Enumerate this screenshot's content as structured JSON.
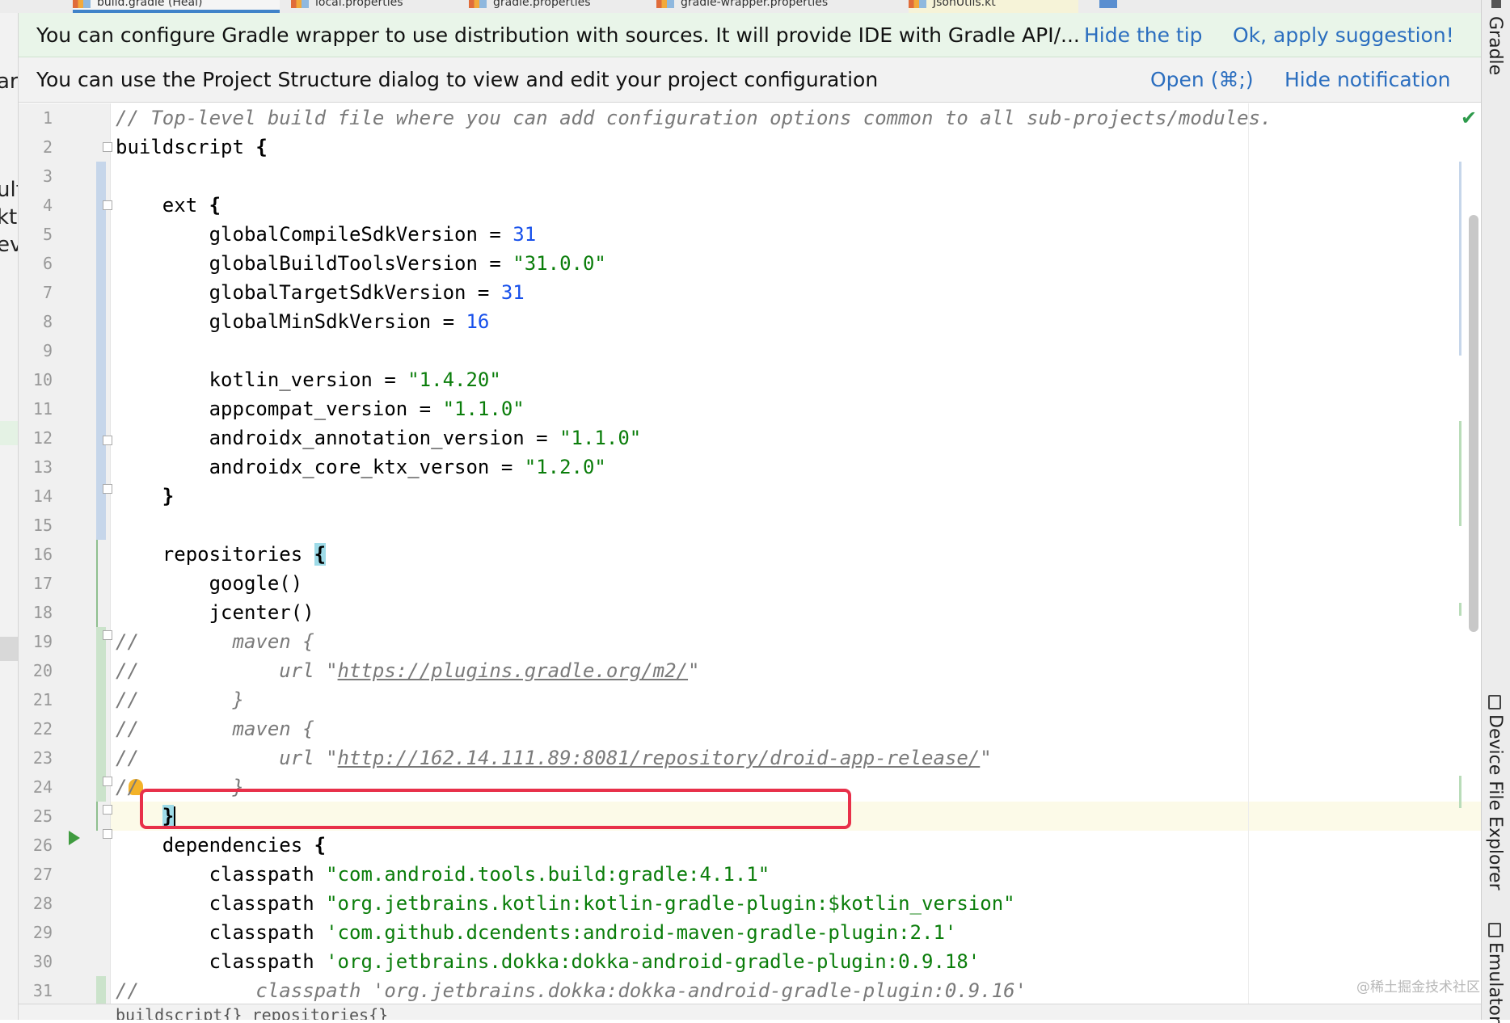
{
  "tabs": [
    {
      "label": "build.gradle (Heal)",
      "active": true
    },
    {
      "label": "local.properties",
      "active": false
    },
    {
      "label": "gradle.properties",
      "active": false
    },
    {
      "label": "gradle-wrapper.properties",
      "active": false
    },
    {
      "label": "JsonUtils.kt",
      "active": false
    }
  ],
  "left_panel": {
    "fragments": [
      "arl",
      "ult",
      "kt",
      "ev"
    ]
  },
  "notifications": {
    "gradle_tip": {
      "text": "You can configure Gradle wrapper to use distribution with sources. It will provide IDE with Gradle API/...",
      "hide_label": "Hide the tip",
      "apply_label": "Ok, apply suggestion!"
    },
    "project_structure": {
      "text": "You can use the Project Structure dialog to view and edit your project configuration",
      "open_label": "Open (⌘;)",
      "hide_label": "Hide notification"
    }
  },
  "editor": {
    "line_numbers": [
      "1",
      "2",
      "3",
      "4",
      "5",
      "6",
      "7",
      "8",
      "9",
      "10",
      "11",
      "12",
      "13",
      "14",
      "15",
      "16",
      "17",
      "18",
      "19",
      "20",
      "21",
      "22",
      "23",
      "24",
      "25",
      "26",
      "27",
      "28",
      "29",
      "30",
      "31"
    ],
    "lines": {
      "l1": "// Top-level build file where you can add configuration options common to all sub-projects/modules.",
      "l2a": "buildscript",
      "l2b": " {",
      "l4a": "    ext",
      "l4b": " {",
      "l5a": "        globalCompileSdkVersion = ",
      "l5b": "31",
      "l6a": "        globalBuildToolsVersion = ",
      "l6b": "\"31.0.0\"",
      "l7a": "        globalTargetSdkVersion = ",
      "l7b": "31",
      "l8a": "        globalMinSdkVersion = ",
      "l8b": "16",
      "l10a": "        kotlin_version = ",
      "l10b": "\"1.4.20\"",
      "l11a": "        appcompat_version = ",
      "l11b": "\"1.1.0\"",
      "l12a": "        androidx_annotation_version = ",
      "l12b": "\"1.1.0\"",
      "l13a": "        androidx_core_ktx_verson = ",
      "l13b": "\"1.2.0\"",
      "l14": "    }",
      "l16a": "    repositories ",
      "l16b": "{",
      "l17": "        google()",
      "l18": "        jcenter()",
      "l19": "//        maven {",
      "l20a": "//            url \"",
      "l20b": "https://plugins.gradle.org/m2/",
      "l20c": "\"",
      "l21": "//        }",
      "l22": "//        maven {",
      "l23a": "//            url \"",
      "l23b": "http://162.14.111.89:8081/repository/droid-app-release/",
      "l23c": "\"",
      "l24": "//        }",
      "l25a": "    ",
      "l25b": "}",
      "l26a": "    dependencies",
      "l26b": " {",
      "l27a": "        classpath ",
      "l27b": "\"com.android.tools.build:gradle:4.1.1\"",
      "l28a": "        classpath ",
      "l28b": "\"org.jetbrains.kotlin:kotlin-gradle-plugin:$kotlin_version\"",
      "l29a": "        classpath ",
      "l29b": "'com.github.dcendents:android-maven-gradle-plugin:2.1'",
      "l30a": "        classpath ",
      "l30b": "'org.jetbrains.dokka:dokka-android-gradle-plugin:0.9.18'",
      "l31": "//          classpath 'org.jetbrains.dokka:dokka-android-gradle-plugin:0.9.16'"
    }
  },
  "breadcrumb": "buildscript{}  repositories{}",
  "right_tools": {
    "gradle": "Gradle",
    "device_explorer": "Device File Explorer",
    "emulator": "Emulator"
  },
  "watermark": "@稀土掘金技术社区",
  "colors": {
    "link": "#2b6ebf",
    "string": "#0a7d0a",
    "number": "#1750eb",
    "comment": "#7a7a7a",
    "highlight_box": "#e8304a"
  }
}
